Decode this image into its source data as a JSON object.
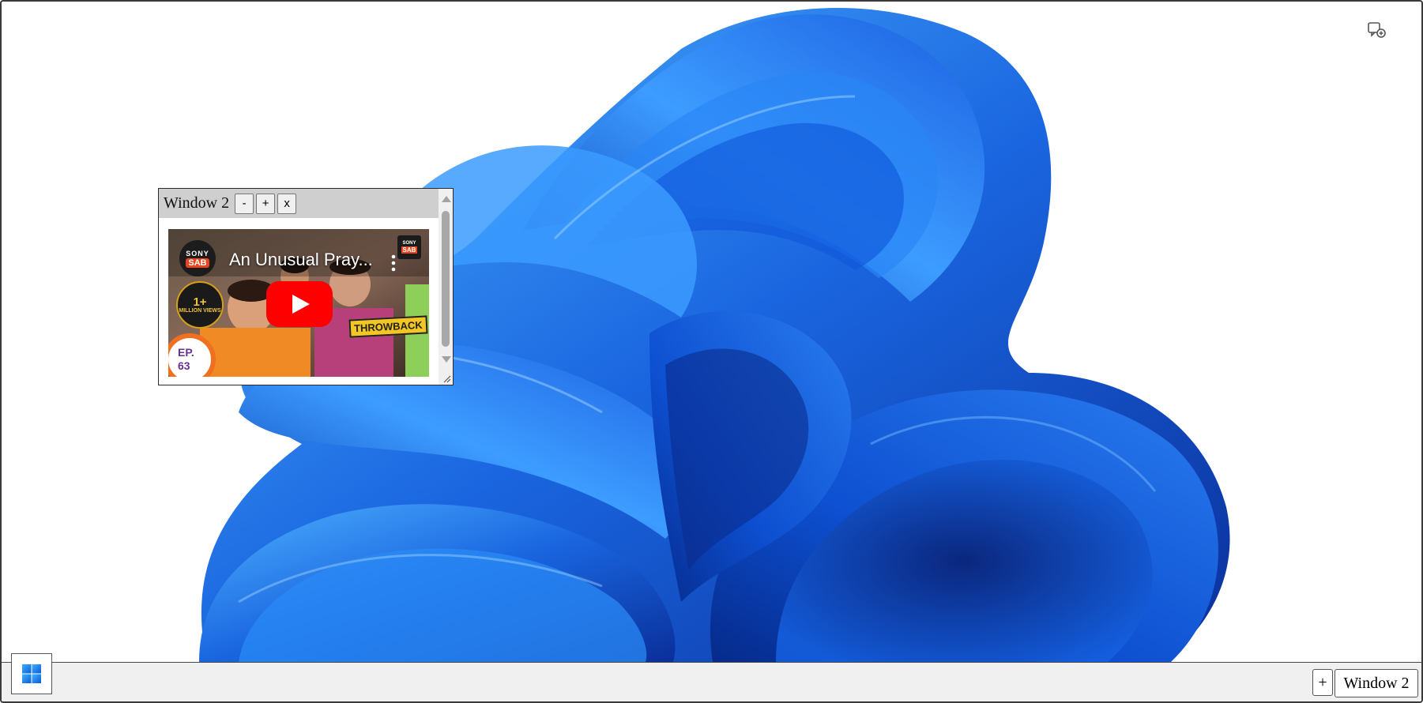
{
  "desktop": {
    "wallpaper": "windows-11-bloom-wallpaper",
    "top_right_icon": "chat-add-icon"
  },
  "window": {
    "title": "Window 2",
    "minimize_label": "-",
    "maximize_label": "+",
    "close_label": "x",
    "video": {
      "title": "An Unusual Pray...",
      "channel_logo_top": "SONY",
      "channel_logo_bottom": "SAB",
      "corner_brand_top": "SONY",
      "corner_brand_bottom": "SAB",
      "million_badge_big": "1+",
      "million_badge_small": "MILLION VIEWS",
      "throwback_label": "THROWBACK",
      "episode_line1": "EP.",
      "episode_line2": "63",
      "play_icon": "youtube-play-icon",
      "menu_icon": "more-vertical-icon"
    }
  },
  "taskbar": {
    "start_icon": "windows-logo-icon",
    "add_label": "+",
    "window_label": "Window 2"
  },
  "colors": {
    "accent_blue": "#1a66e0",
    "youtube_red": "#ff0000",
    "taskbar_bg": "#f0f0f0",
    "window_header": "#cfcfcf"
  }
}
